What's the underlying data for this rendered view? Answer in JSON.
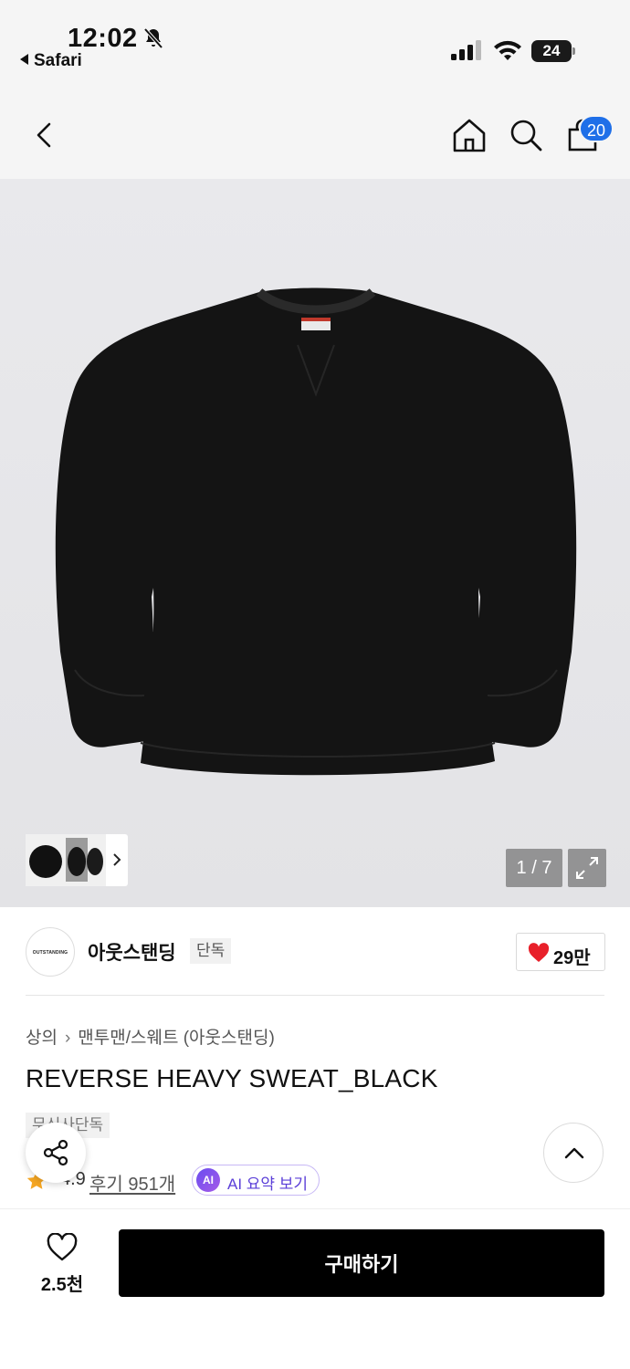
{
  "status_bar": {
    "time": "12:02",
    "back_app": "Safari",
    "battery": "24"
  },
  "header": {
    "cart_count": "20",
    "icons": [
      "back-icon",
      "home-icon",
      "search-icon",
      "shopping-bag-icon"
    ]
  },
  "gallery": {
    "counter": "1 / 7",
    "expand_icon": "expand-icon"
  },
  "brand": {
    "logo_text": "OUTSTANDING",
    "name": "아웃스탠딩",
    "tag": "단독",
    "like_count": "29만"
  },
  "product": {
    "breadcrumb": [
      "상의",
      "맨투맨/스웨트 (아웃스탠딩)"
    ],
    "title": "REVERSE HEAVY SWEAT_BLACK",
    "site_tag": "무신사단독",
    "rating": "4.9",
    "reviews": "후기 951개",
    "ai_badge": "AI",
    "ai_summary": "AI 요약 보기"
  },
  "bottom_bar": {
    "wish_count": "2.5천",
    "buy_label": "구매하기"
  },
  "colors": {
    "accent_blue": "#1f6fe8",
    "heart_red": "#e8202a",
    "ai_purple": "#5b3fd8",
    "star_orange": "#f5a623"
  }
}
